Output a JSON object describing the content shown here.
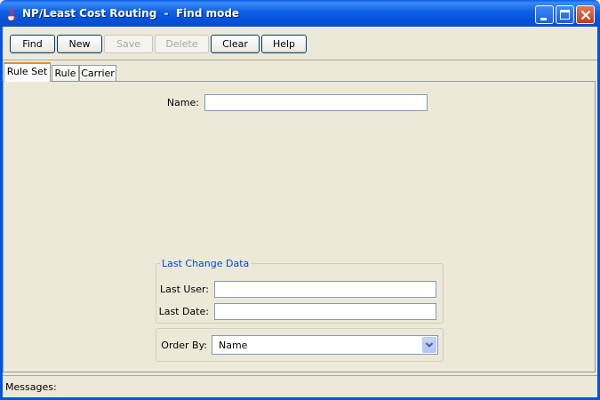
{
  "window": {
    "title": "NP/Least Cost Routing  -  Find mode",
    "controls": [
      "minimize",
      "maximize",
      "close"
    ]
  },
  "toolbar": {
    "buttons": [
      {
        "label": "Find",
        "enabled": true
      },
      {
        "label": "New",
        "enabled": true
      },
      {
        "label": "Save",
        "enabled": false
      },
      {
        "label": "Delete",
        "enabled": false
      },
      {
        "label": "Clear",
        "enabled": true
      },
      {
        "label": "Help",
        "enabled": true
      }
    ]
  },
  "tabs": [
    {
      "label": "Rule Set",
      "active": true
    },
    {
      "label": "Rule",
      "active": false
    },
    {
      "label": "Carrier",
      "active": false
    }
  ],
  "form": {
    "name_label": "Name:",
    "name_value": "",
    "last_change": {
      "legend": "Last Change Data",
      "last_user_label": "Last User:",
      "last_user_value": "",
      "last_date_label": "Last Date:",
      "last_date_value": ""
    },
    "order_by": {
      "label": "Order By:",
      "selected": "Name"
    }
  },
  "status": {
    "messages_label": "Messages:"
  },
  "colors": {
    "title_bar": "#0054e3",
    "client_bg": "#ece9d8",
    "group_legend": "#0046d5",
    "active_tab_accent": "#e68b2c"
  },
  "icons": {
    "app": "java-coffee-cup-icon",
    "combo_arrow": "chevron-down-icon"
  }
}
